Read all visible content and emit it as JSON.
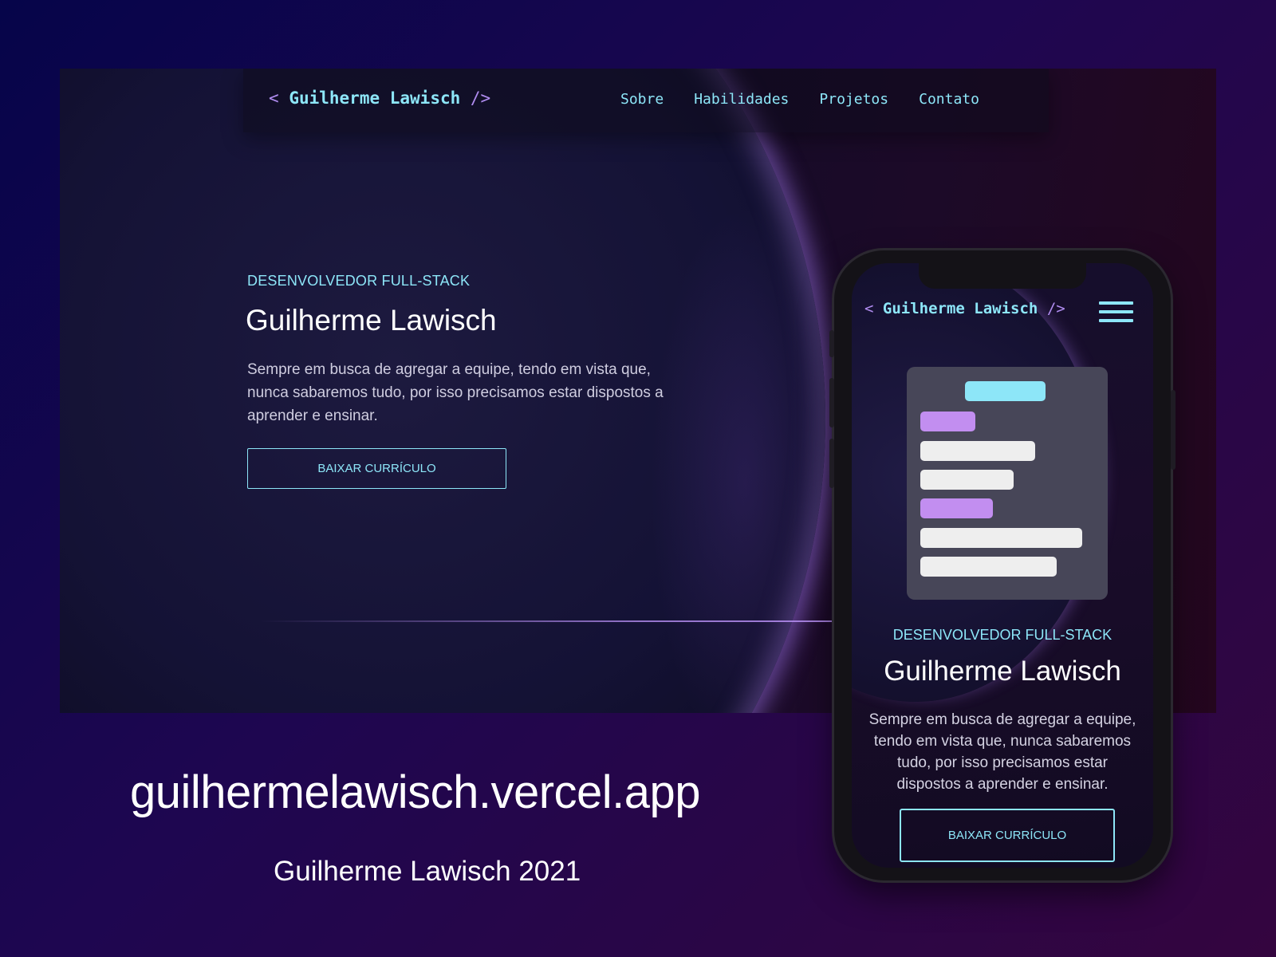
{
  "desktop": {
    "logo": {
      "open": "<",
      "name": "Guilherme Lawisch",
      "close": "/>"
    },
    "nav": [
      "Sobre",
      "Habilidades",
      "Projetos",
      "Contato"
    ],
    "hero": {
      "subtitle": "DESENVOLVEDOR FULL-STACK",
      "title": "Guilherme Lawisch",
      "description": "Sempre em busca de agregar a equipe, tendo em vista que, nunca sabaremos tudo, por isso precisamos estar dispostos a aprender e ensinar.",
      "button": "BAIXAR CURRÍCULO"
    }
  },
  "mobile": {
    "logo": {
      "open": "<",
      "name": "Guilherme Lawisch",
      "close": "/>"
    },
    "menu_icon": "hamburger-icon",
    "hero": {
      "subtitle": "DESENVOLVEDOR FULL-STACK",
      "title": "Guilherme Lawisch",
      "description": "Sempre em busca de agregar a equipe, tendo em vista que, nunca sabaremos tudo, por isso precisamos estar dispostos a aprender e ensinar.",
      "button": "BAIXAR CURRÍCULO"
    }
  },
  "caption": {
    "url": "guilhermelawisch.vercel.app",
    "footer": "Guilherme Lawisch 2021"
  },
  "colors": {
    "accent_cyan": "#8de6f8",
    "accent_purple": "#b08cf0",
    "card_gray": "#474658",
    "background_start": "#06054a",
    "background_end": "#34053f"
  }
}
